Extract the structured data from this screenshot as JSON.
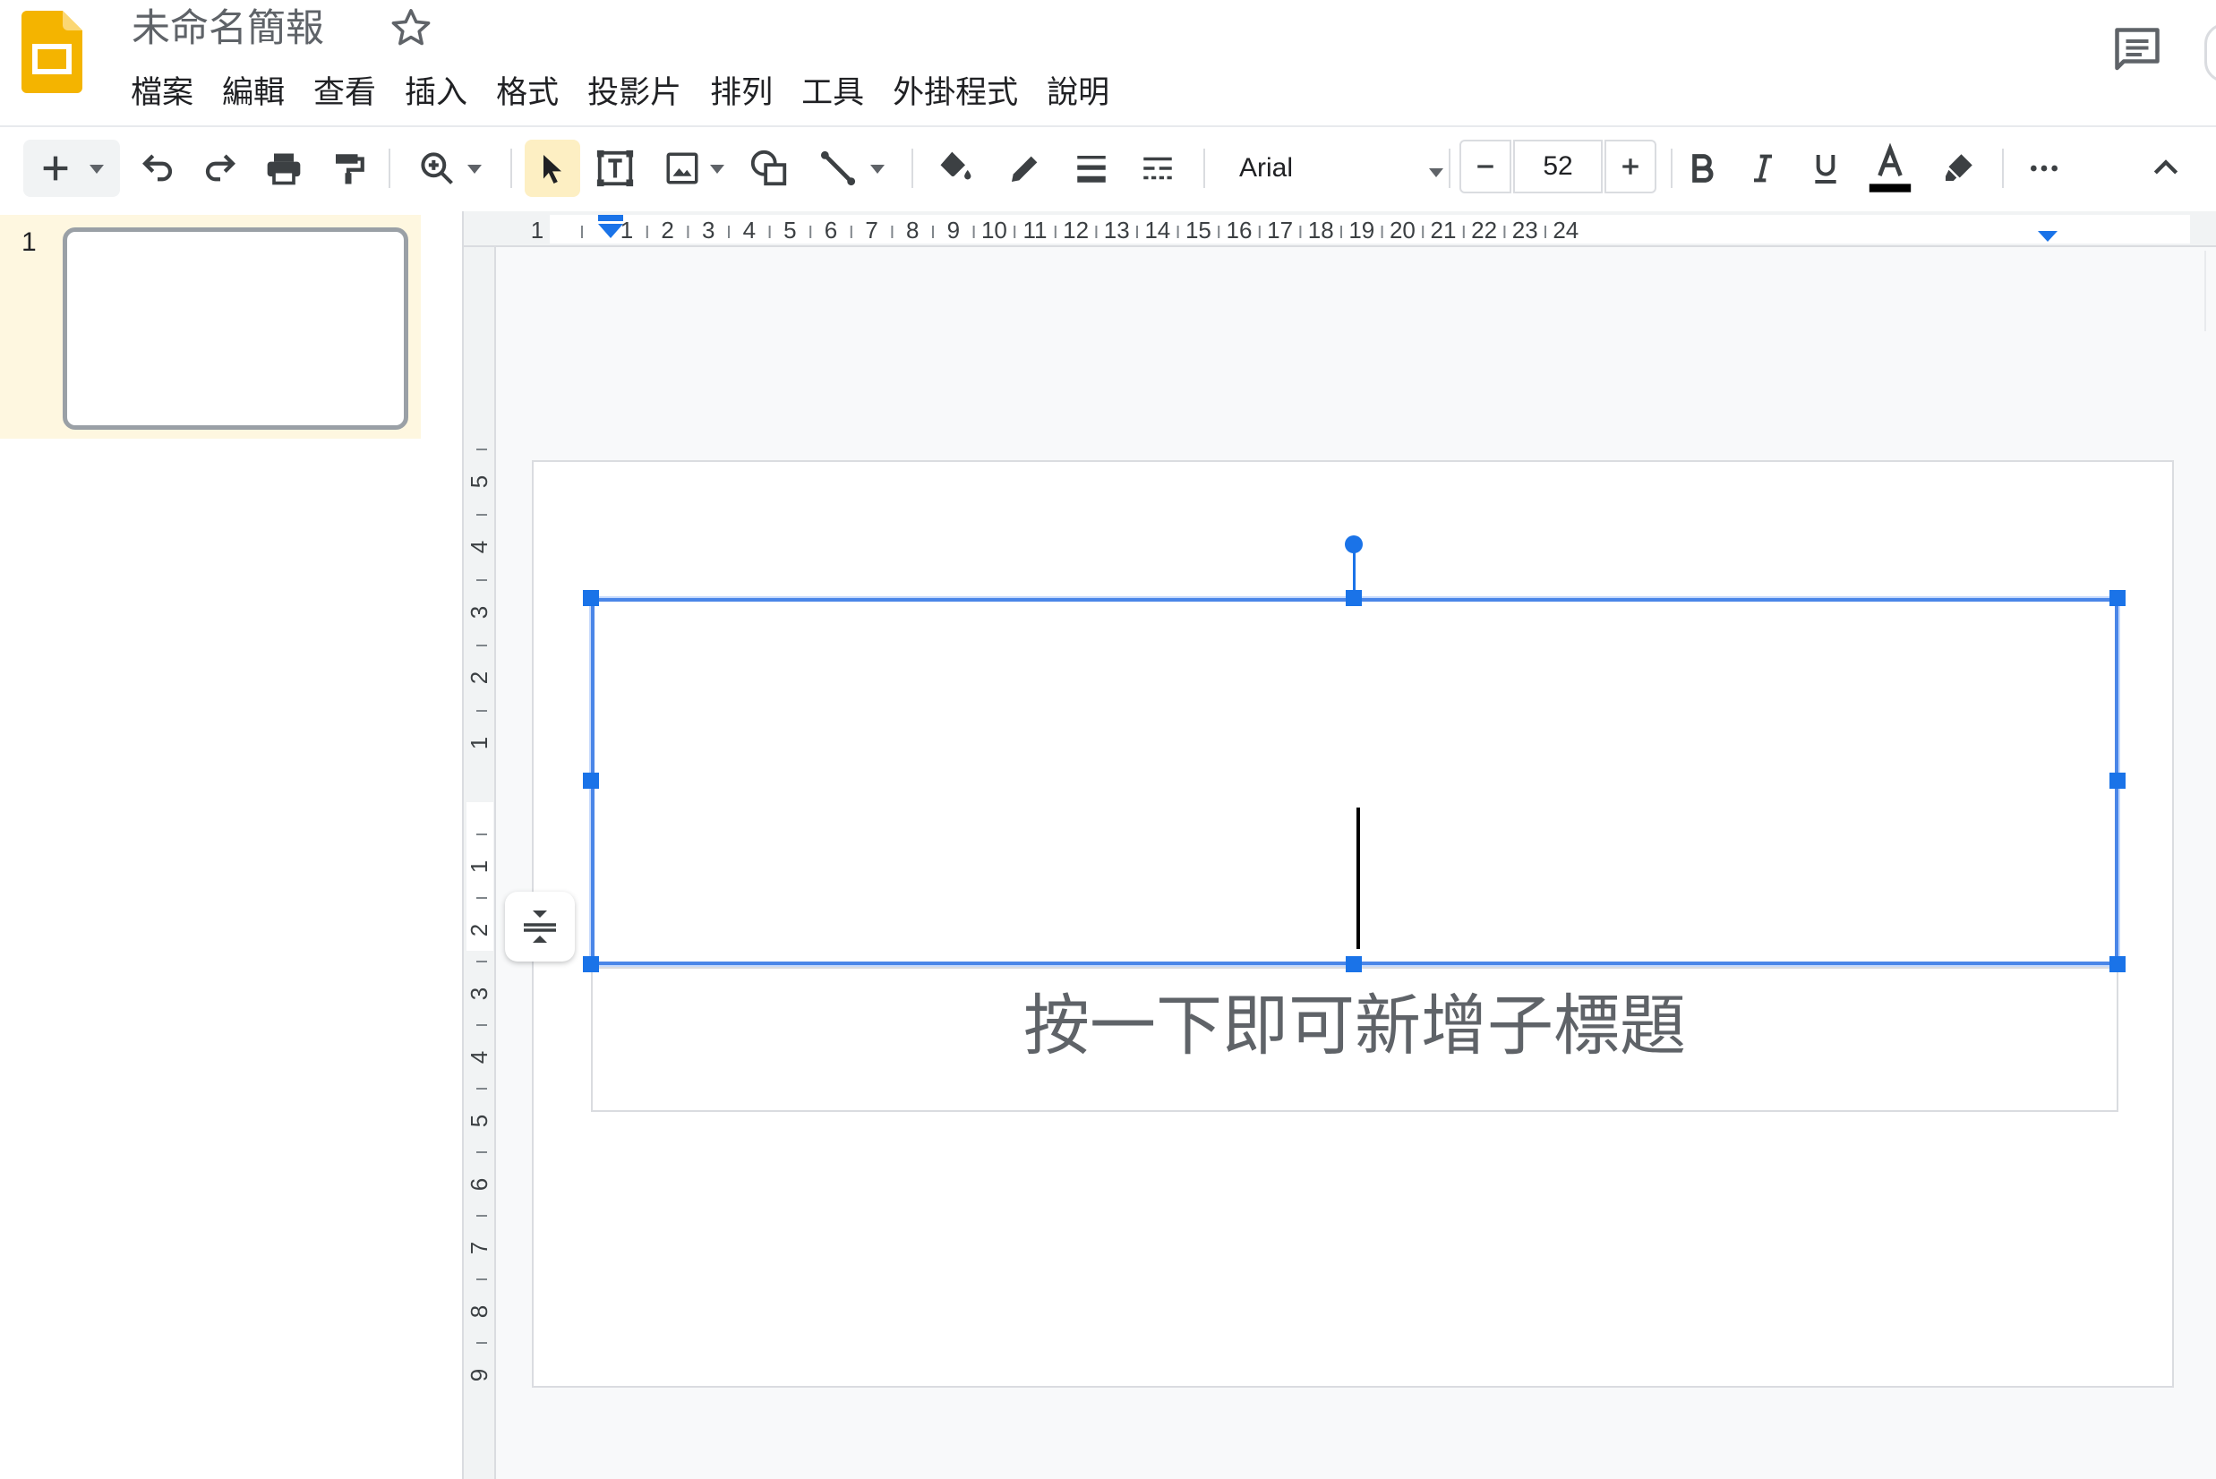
{
  "header": {
    "doc_title": "未命名簡報",
    "menu": [
      "檔案",
      "編輯",
      "查看",
      "插入",
      "格式",
      "投影片",
      "排列",
      "工具",
      "外掛程式",
      "說明"
    ]
  },
  "toolbar": {
    "font_name": "Arial",
    "font_size": "52",
    "icons": [
      "add-icon",
      "undo-icon",
      "redo-icon",
      "print-icon",
      "paint-format-icon",
      "zoom-icon",
      "select-icon",
      "text-box-icon",
      "image-icon",
      "shape-icon",
      "line-icon",
      "fill-color-icon",
      "border-color-icon",
      "border-weight-icon",
      "border-dash-icon",
      "bold-icon",
      "italic-icon",
      "underline-icon",
      "text-color-icon",
      "highlight-icon",
      "more-icon",
      "collapse-icon"
    ]
  },
  "filmstrip": {
    "slides": [
      {
        "number": "1"
      }
    ]
  },
  "rulers": {
    "horizontal": [
      "1",
      "1",
      "2",
      "3",
      "4",
      "5",
      "6",
      "7",
      "8",
      "9",
      "10",
      "11",
      "12",
      "13",
      "14",
      "15",
      "16",
      "17",
      "18",
      "19",
      "20",
      "21",
      "22",
      "23",
      "24"
    ],
    "vertical": [
      "5",
      "4",
      "3",
      "2",
      "1",
      "1",
      "2",
      "3",
      "4",
      "5",
      "6",
      "7",
      "8",
      "9"
    ]
  },
  "slide": {
    "subtitle_placeholder": "按一下即可新增子標題"
  },
  "colors": {
    "brand_yellow": "#f4b400",
    "selection_blue": "#1a73e8",
    "select_tool_active": "#fdefc3",
    "filmstrip_selected": "#fef7e0",
    "text_color_bar": "#000000"
  }
}
